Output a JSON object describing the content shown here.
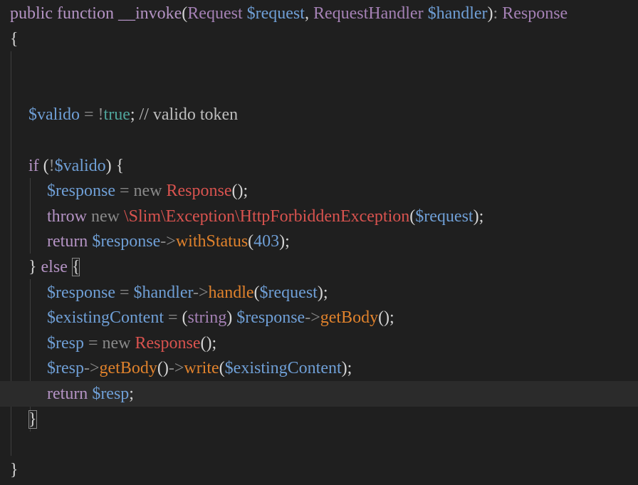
{
  "editor": {
    "language": "php",
    "theme_colors": {
      "background": "#1f1f1f",
      "current_line": "#2b2b2b",
      "keyword": "#b493c4",
      "variable": "#6f9fd6",
      "class": "#d9534f",
      "method": "#e0822c",
      "boolean": "#4fa59c",
      "operator": "#8a8a8a",
      "comment": "#bdbdbd"
    },
    "lines": [
      {
        "tokens": [
          {
            "t": "public function ",
            "c": "kw"
          },
          {
            "t": "__invoke",
            "c": "fn"
          },
          {
            "t": "(",
            "c": "punc"
          },
          {
            "t": "Request",
            "c": "type"
          },
          {
            "t": " ",
            "c": "plain"
          },
          {
            "t": "$request",
            "c": "var"
          },
          {
            "t": ", ",
            "c": "punc"
          },
          {
            "t": "RequestHandler",
            "c": "type"
          },
          {
            "t": " ",
            "c": "plain"
          },
          {
            "t": "$handler",
            "c": "var"
          },
          {
            "t": ")",
            "c": "punc"
          },
          {
            "t": ": ",
            "c": "kw2"
          },
          {
            "t": "Response",
            "c": "type"
          }
        ]
      },
      {
        "tokens": [
          {
            "t": "{",
            "c": "punc"
          }
        ]
      },
      {
        "tokens": []
      },
      {
        "tokens": []
      },
      {
        "tokens": [
          {
            "t": "$valido",
            "c": "var"
          },
          {
            "t": " = ",
            "c": "op"
          },
          {
            "t": "!",
            "c": "op"
          },
          {
            "t": "true",
            "c": "bool"
          },
          {
            "t": "; ",
            "c": "punc"
          },
          {
            "t": "// valido token",
            "c": "cmt"
          }
        ]
      },
      {
        "tokens": []
      },
      {
        "tokens": [
          {
            "t": "if",
            "c": "kw"
          },
          {
            "t": " (",
            "c": "punc"
          },
          {
            "t": "!",
            "c": "op"
          },
          {
            "t": "$valido",
            "c": "var"
          },
          {
            "t": ") {",
            "c": "punc"
          }
        ]
      },
      {
        "tokens": [
          {
            "t": "$response",
            "c": "var"
          },
          {
            "t": " = ",
            "c": "op"
          },
          {
            "t": "new ",
            "c": "kw2"
          },
          {
            "t": "Response",
            "c": "cls"
          },
          {
            "t": "();",
            "c": "punc"
          }
        ]
      },
      {
        "tokens": [
          {
            "t": "throw",
            "c": "kw"
          },
          {
            "t": " new ",
            "c": "kw2"
          },
          {
            "t": "\\Slim\\Exception\\HttpForbiddenException",
            "c": "cls"
          },
          {
            "t": "(",
            "c": "punc"
          },
          {
            "t": "$request",
            "c": "var"
          },
          {
            "t": ");",
            "c": "punc"
          }
        ]
      },
      {
        "tokens": [
          {
            "t": "return",
            "c": "kw"
          },
          {
            "t": " ",
            "c": "plain"
          },
          {
            "t": "$response",
            "c": "var"
          },
          {
            "t": "->",
            "c": "op"
          },
          {
            "t": "withStatus",
            "c": "meth"
          },
          {
            "t": "(",
            "c": "punc"
          },
          {
            "t": "403",
            "c": "num"
          },
          {
            "t": ");",
            "c": "punc"
          }
        ]
      },
      {
        "tokens": [
          {
            "t": "} ",
            "c": "punc"
          },
          {
            "t": "else",
            "c": "kw"
          },
          {
            "t": " ",
            "c": "plain"
          },
          {
            "t": "{",
            "c": "punc",
            "hl": true
          }
        ]
      },
      {
        "tokens": [
          {
            "t": "$response",
            "c": "var"
          },
          {
            "t": " = ",
            "c": "op"
          },
          {
            "t": "$handler",
            "c": "var"
          },
          {
            "t": "->",
            "c": "op"
          },
          {
            "t": "handle",
            "c": "meth"
          },
          {
            "t": "(",
            "c": "punc"
          },
          {
            "t": "$request",
            "c": "var"
          },
          {
            "t": ");",
            "c": "punc"
          }
        ]
      },
      {
        "tokens": [
          {
            "t": "$existingContent",
            "c": "var"
          },
          {
            "t": " = ",
            "c": "op"
          },
          {
            "t": "(",
            "c": "punc"
          },
          {
            "t": "string",
            "c": "type"
          },
          {
            "t": ") ",
            "c": "punc"
          },
          {
            "t": "$response",
            "c": "var"
          },
          {
            "t": "->",
            "c": "op"
          },
          {
            "t": "getBody",
            "c": "meth"
          },
          {
            "t": "();",
            "c": "punc"
          }
        ]
      },
      {
        "tokens": [
          {
            "t": "$resp",
            "c": "var"
          },
          {
            "t": " = ",
            "c": "op"
          },
          {
            "t": "new ",
            "c": "kw2"
          },
          {
            "t": "Response",
            "c": "cls"
          },
          {
            "t": "();",
            "c": "punc"
          }
        ]
      },
      {
        "tokens": [
          {
            "t": "$resp",
            "c": "var"
          },
          {
            "t": "->",
            "c": "op"
          },
          {
            "t": "getBody",
            "c": "meth"
          },
          {
            "t": "()",
            "c": "punc"
          },
          {
            "t": "->",
            "c": "op"
          },
          {
            "t": "write",
            "c": "meth"
          },
          {
            "t": "(",
            "c": "punc"
          },
          {
            "t": "$existingContent",
            "c": "var"
          },
          {
            "t": ");",
            "c": "punc"
          }
        ]
      },
      {
        "tokens": [
          {
            "t": "return",
            "c": "kw"
          },
          {
            "t": " ",
            "c": "plain"
          },
          {
            "t": "$resp",
            "c": "var"
          },
          {
            "t": ";",
            "c": "punc"
          }
        ]
      },
      {
        "tokens": [
          {
            "t": "}",
            "c": "punc",
            "hl": true
          }
        ]
      },
      {
        "tokens": []
      },
      {
        "tokens": [
          {
            "t": "}",
            "c": "punc"
          }
        ]
      }
    ]
  }
}
